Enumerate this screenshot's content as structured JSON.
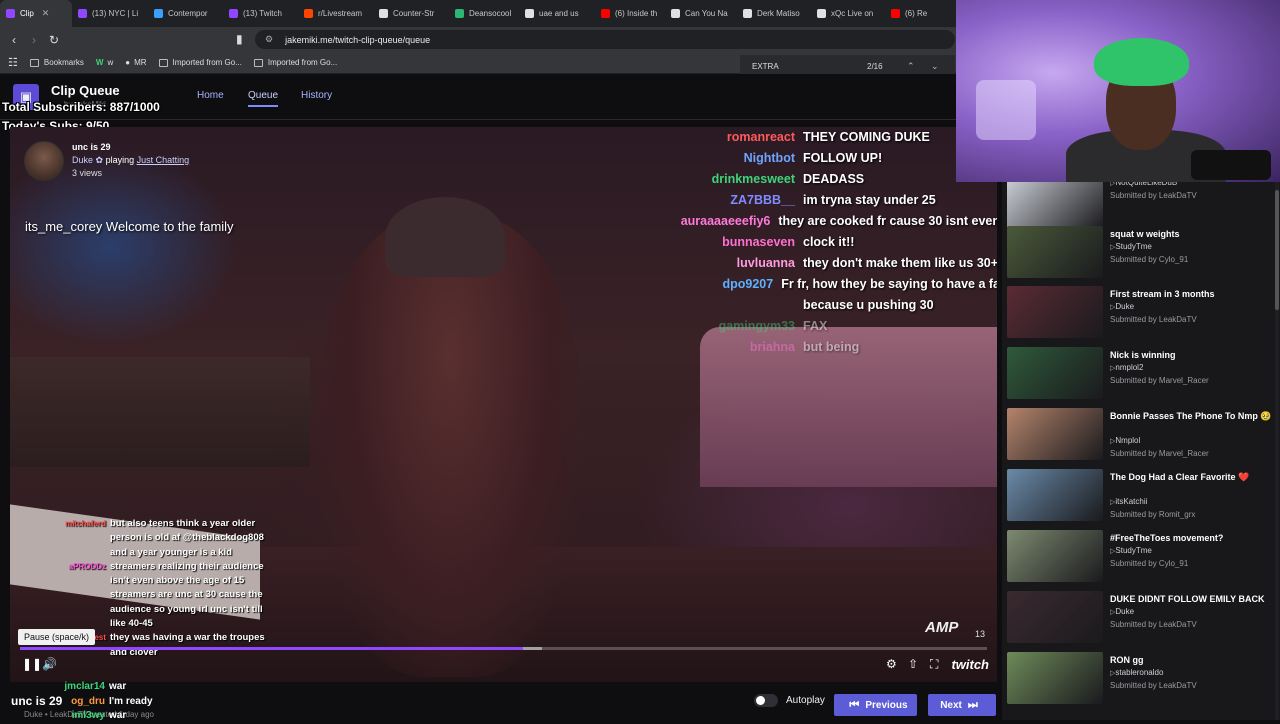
{
  "tabs": [
    {
      "label": "Clip",
      "color": "#9147ff",
      "active": true
    },
    {
      "label": "(13) NYC | Li",
      "color": "#9147ff"
    },
    {
      "label": "Contempor",
      "color": "#3aa0ff"
    },
    {
      "label": "(13) Twitch",
      "color": "#9147ff"
    },
    {
      "label": "r/Livestream",
      "color": "#ff4500"
    },
    {
      "label": "Counter-Str",
      "color": "#e0e0e0"
    },
    {
      "label": "Deansocool",
      "color": "#2bb673"
    },
    {
      "label": "uae and us",
      "color": "#e0e0e0"
    },
    {
      "label": "(6) Inside th",
      "color": "#ff0000"
    },
    {
      "label": "Can You Na",
      "color": "#e0e0e0"
    },
    {
      "label": "Derk Matiso",
      "color": "#e0e0e0"
    },
    {
      "label": "xQc Live on",
      "color": "#e0e0e0"
    },
    {
      "label": "(6) Re",
      "color": "#ff0000"
    }
  ],
  "browser": {
    "url": "jakemiki.me/twitch-clip-queue/queue",
    "bookmarks": [
      "Bookmarks",
      "w",
      "MR",
      "Imported from Go...",
      "Imported from Go..."
    ],
    "find_query": "EXTRA",
    "find_count": "2/16"
  },
  "app": {
    "title": "Clip Queue",
    "subtitle": "by JakeMiki",
    "nav": [
      "Home",
      "Queue",
      "History"
    ],
    "active_nav": "Queue"
  },
  "overlay": {
    "subscribers": "Total Subscribers: 887/1000",
    "today_subs": "Today's Subs: 9/50"
  },
  "clip": {
    "title": "unc is 29",
    "channel": "Duke",
    "playing": "playing",
    "game": "Just Chatting",
    "views": "3 views",
    "overlay_chat": "its_me_corey Welcome to the family",
    "bottom_title": "unc is 29",
    "bottom_meta": "Duke • LeakDaTV   created 1 day ago",
    "tooltip": "Pause (space/k)",
    "progress": 0.52,
    "viewer_count": "13",
    "brand": "twitch",
    "amp": "AMP"
  },
  "chat_right": [
    {
      "user": "romanreact",
      "msg": "THEY COMING DUKE",
      "color": "#ff5a5a"
    },
    {
      "user": "Nightbot",
      "msg": "FOLLOW UP!",
      "color": "#6ea4ff"
    },
    {
      "user": "drinkmesweet",
      "msg": "DEADASS",
      "color": "#3fd37a"
    },
    {
      "user": "ZA7BBB__",
      "msg": "im tryna stay under 25",
      "color": "#7e8cff"
    },
    {
      "user": "auraaaaeeefiy6",
      "msg": "they are cooked fr cause 30 isnt even",
      "color": "#ff7ad9"
    },
    {
      "user": "bunnaseven",
      "msg": "clock it!!",
      "color": "#ff6ed0"
    },
    {
      "user": "luvluanna",
      "msg": "they don't make them like us 30+",
      "color": "#ff9ce0"
    },
    {
      "user": "dpo9207",
      "msg": "Fr fr, how they be saying to have a fa",
      "color": "#5fb0ff"
    },
    {
      "user": "",
      "msg": "because u pushing 30",
      "color": "#ffffff"
    },
    {
      "user": "gamingym33",
      "msg": "FAX",
      "color": "#3fd37a"
    },
    {
      "user": "briahna",
      "msg": "but being",
      "color": "#ff7ad9"
    }
  ],
  "chat_left": [
    {
      "user": "mitchaferd",
      "msg": "but also teens think a year older person is old af @theblackdog808 and a year younger is a kid",
      "color": "#ff4b4b"
    },
    {
      "user": "aPRODDz",
      "msg": "streamers realizing their audience isn't even above the age of 15 streamers are unc at 30 cause the audience so young irl unc isn't till like 40-45",
      "color": "#ff4fd8"
    },
    {
      "user": "thegreatest",
      "msg": "they was having a war the troupes and clover",
      "color": "#ff4b4b"
    }
  ],
  "chat_bottom": [
    {
      "user": "jmclar14",
      "msg": "war",
      "color": "#3fd37a"
    },
    {
      "user": "og_dru",
      "msg": "I'm ready",
      "color": "#ff9a3c"
    },
    {
      "user": "iml3wy",
      "msg": "war",
      "color": "#3fd37a"
    }
  ],
  "controls": {
    "autoplay_label": "Autoplay",
    "previous_label": "Previous",
    "next_label": "Next"
  },
  "queue": [
    {
      "title": "",
      "channel": "NotQuiteLikeDuB",
      "submitted": "Submitted by LeakDaTV",
      "thumb": "#cfd3da"
    },
    {
      "title": "squat w weights",
      "channel": "StudyTme",
      "submitted": "Submitted by Cylo_91",
      "thumb": "#4a5a3a"
    },
    {
      "title": "First stream in 3 months",
      "channel": "Duke",
      "submitted": "Submitted by LeakDaTV",
      "thumb": "#5a2b35"
    },
    {
      "title": "Nick is winning",
      "channel": "nmplol2",
      "submitted": "Submitted by Marvel_Racer",
      "thumb": "#2f5a3a"
    },
    {
      "title": "Bonnie Passes The Phone To Nmp 🥹",
      "channel": "Nmplol",
      "submitted": "Submitted by Marvel_Racer",
      "thumb": "#b4846c"
    },
    {
      "title": "The Dog Had a Clear Favorite ❤️",
      "channel": "itsKatchii",
      "submitted": "Submitted by Romit_grx",
      "thumb": "#6a8aa8"
    },
    {
      "title": "#FreeTheToes movement?",
      "channel": "StudyTme",
      "submitted": "Submitted by Cylo_91",
      "thumb": "#7d8a70"
    },
    {
      "title": "DUKE DIDNT FOLLOW EMILY BACK",
      "channel": "Duke",
      "submitted": "Submitted by LeakDaTV",
      "thumb": "#3a2a30"
    },
    {
      "title": "RON gg",
      "channel": "stableronaldo",
      "submitted": "Submitted by LeakDaTV",
      "thumb": "#6e8a5a"
    }
  ]
}
